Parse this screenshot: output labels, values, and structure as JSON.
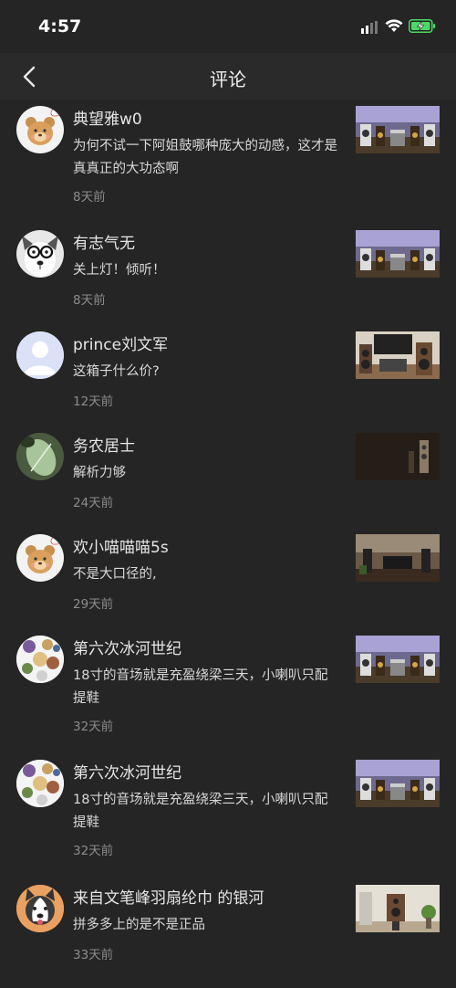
{
  "status_bar": {
    "time": "4:57",
    "signal_icon": "cellular-signal-icon",
    "wifi_icon": "wifi-icon",
    "battery_icon": "battery-charging-icon"
  },
  "nav": {
    "title": "评论",
    "back_icon": "chevron-left-icon"
  },
  "comments": [
    {
      "username": "典望雅w0",
      "text": "为何不试一下阿姐鼓哪种庞大的动感，这才是真真正的大功态啊",
      "time": "8天前"
    },
    {
      "username": "有志气无",
      "text": "关上灯！倾听！",
      "time": "8天前"
    },
    {
      "username": "prince刘文军",
      "text": "这箱子什么价?",
      "time": "12天前"
    },
    {
      "username": "务农居士",
      "text": "解析力够",
      "time": "24天前"
    },
    {
      "username": "欢小喵喵喵5s",
      "text": "不是大口径的,",
      "time": "29天前"
    },
    {
      "username": "第六次冰河世纪",
      "text": "18寸的音场就是充盈绕梁三天，小喇叭只配提鞋",
      "time": "32天前"
    },
    {
      "username": "第六次冰河世纪",
      "text": "18寸的音场就是充盈绕梁三天，小喇叭只配提鞋",
      "time": "32天前"
    },
    {
      "username": "来自文笔峰羽扇纶巾 的银河",
      "text": "拼多多上的是不是正品",
      "time": "33天前"
    }
  ],
  "colors": {
    "background": "#252525",
    "nav_background": "#2a2a2a",
    "muted_text": "#8c8c8c"
  }
}
